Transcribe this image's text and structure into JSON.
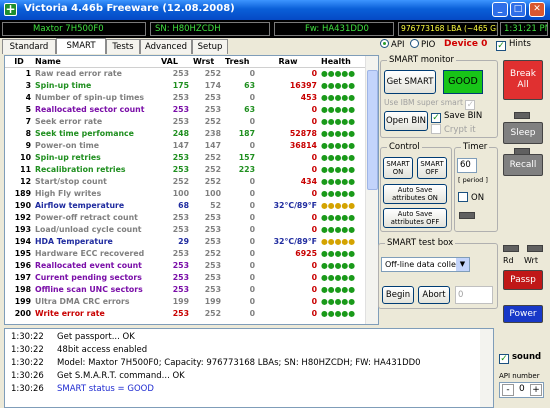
{
  "window": {
    "title": "Victoria 4.46b Freeware (12.08.2008)",
    "controls": {
      "minimize": "_",
      "maximize": "□",
      "close": "✕"
    }
  },
  "infobar": {
    "model": "Maxtor 7H500F0",
    "serial": "SN: H80HZCDH",
    "firmware": "Fw: HA431DD0",
    "lba": "976773168 LBA (~465 GB)",
    "time": "1:31:21 PM"
  },
  "tabs": [
    "Standard",
    "SMART",
    "Tests",
    "Advanced",
    "Setup"
  ],
  "active_tab": "SMART",
  "mode": {
    "api": "API",
    "pio": "PIO",
    "device": "Device 0",
    "selected": "API"
  },
  "hints_label": "Hints",
  "hints_checked": true,
  "smart_table": {
    "headers": [
      "ID",
      "Name",
      "VAL",
      "Wrst",
      "Tresh",
      "Raw",
      "Health"
    ],
    "rows": [
      {
        "id": "1",
        "name": "Raw read error rate",
        "val": "253",
        "wrst": "252",
        "tresh": "0",
        "raw": "0",
        "health": "●●●●●",
        "color": "grey",
        "tresh_color": "grey",
        "raw_color": "red"
      },
      {
        "id": "3",
        "name": "Spin-up time",
        "val": "175",
        "wrst": "174",
        "tresh": "63",
        "raw": "16397",
        "health": "●●●●●",
        "color": "green",
        "tresh_color": "green",
        "raw_color": "red"
      },
      {
        "id": "4",
        "name": "Number of spin-up times",
        "val": "253",
        "wrst": "253",
        "tresh": "0",
        "raw": "453",
        "health": "●●●●●",
        "color": "grey",
        "tresh_color": "grey",
        "raw_color": "red"
      },
      {
        "id": "5",
        "name": "Reallocated sector count",
        "val": "253",
        "wrst": "253",
        "tresh": "63",
        "raw": "0",
        "health": "●●●●●",
        "color": "purple",
        "tresh_color": "green",
        "raw_color": "red"
      },
      {
        "id": "7",
        "name": "Seek error rate",
        "val": "253",
        "wrst": "252",
        "tresh": "0",
        "raw": "0",
        "health": "●●●●●",
        "color": "grey",
        "tresh_color": "grey",
        "raw_color": "red"
      },
      {
        "id": "8",
        "name": "Seek time perfomance",
        "val": "248",
        "wrst": "238",
        "tresh": "187",
        "raw": "52878",
        "health": "●●●●●",
        "color": "green",
        "tresh_color": "green",
        "raw_color": "red"
      },
      {
        "id": "9",
        "name": "Power-on time",
        "val": "147",
        "wrst": "147",
        "tresh": "0",
        "raw": "36814",
        "health": "●●●●●",
        "color": "grey",
        "tresh_color": "grey",
        "raw_color": "red"
      },
      {
        "id": "10",
        "name": "Spin-up retries",
        "val": "253",
        "wrst": "252",
        "tresh": "157",
        "raw": "0",
        "health": "●●●●●",
        "color": "green",
        "tresh_color": "green",
        "raw_color": "red"
      },
      {
        "id": "11",
        "name": "Recalibration retries",
        "val": "253",
        "wrst": "252",
        "tresh": "223",
        "raw": "0",
        "health": "●●●●●",
        "color": "green",
        "tresh_color": "green",
        "raw_color": "red"
      },
      {
        "id": "12",
        "name": "Start/stop count",
        "val": "252",
        "wrst": "252",
        "tresh": "0",
        "raw": "434",
        "health": "●●●●●",
        "color": "grey",
        "tresh_color": "grey",
        "raw_color": "red"
      },
      {
        "id": "189",
        "name": "High Fly writes",
        "val": "100",
        "wrst": "100",
        "tresh": "0",
        "raw": "0",
        "health": "●●●●●",
        "color": "grey",
        "tresh_color": "grey",
        "raw_color": "red"
      },
      {
        "id": "190",
        "name": "Airflow temperature",
        "val": "68",
        "wrst": "52",
        "tresh": "0",
        "raw": "32°C/89°F",
        "health": "●●●●●",
        "color": "navy",
        "tresh_color": "grey",
        "raw_color": "navy",
        "health_color": "yellow"
      },
      {
        "id": "192",
        "name": "Power-off retract count",
        "val": "253",
        "wrst": "253",
        "tresh": "0",
        "raw": "0",
        "health": "●●●●●",
        "color": "grey",
        "tresh_color": "grey",
        "raw_color": "red"
      },
      {
        "id": "193",
        "name": "Load/unload cycle count",
        "val": "253",
        "wrst": "253",
        "tresh": "0",
        "raw": "0",
        "health": "●●●●●",
        "color": "grey",
        "tresh_color": "grey",
        "raw_color": "red"
      },
      {
        "id": "194",
        "name": "HDA Temperature",
        "val": "29",
        "wrst": "253",
        "tresh": "0",
        "raw": "32°C/89°F",
        "health": "●●●●●",
        "color": "navy",
        "tresh_color": "grey",
        "raw_color": "navy",
        "health_color": "yellow"
      },
      {
        "id": "195",
        "name": "Hardware ECC recovered",
        "val": "253",
        "wrst": "252",
        "tresh": "0",
        "raw": "6925",
        "health": "●●●●●",
        "color": "grey",
        "tresh_color": "grey",
        "raw_color": "red"
      },
      {
        "id": "196",
        "name": "Reallocated event count",
        "val": "253",
        "wrst": "253",
        "tresh": "0",
        "raw": "0",
        "health": "●●●●●",
        "color": "purple",
        "tresh_color": "grey",
        "raw_color": "red"
      },
      {
        "id": "197",
        "name": "Current pending sectors",
        "val": "253",
        "wrst": "253",
        "tresh": "0",
        "raw": "0",
        "health": "●●●●●",
        "color": "purple",
        "tresh_color": "grey",
        "raw_color": "red"
      },
      {
        "id": "198",
        "name": "Offline scan UNC sectors",
        "val": "253",
        "wrst": "253",
        "tresh": "0",
        "raw": "0",
        "health": "●●●●●",
        "color": "purple",
        "tresh_color": "grey",
        "raw_color": "red"
      },
      {
        "id": "199",
        "name": "Ultra DMA CRC errors",
        "val": "199",
        "wrst": "199",
        "tresh": "0",
        "raw": "0",
        "health": "●●●●●",
        "color": "grey",
        "tresh_color": "grey",
        "raw_color": "red"
      },
      {
        "id": "200",
        "name": "Write error rate",
        "val": "253",
        "wrst": "252",
        "tresh": "0",
        "raw": "0",
        "health": "●●●●●",
        "color": "red",
        "tresh_color": "grey",
        "raw_color": "red"
      }
    ]
  },
  "smart_monitor": {
    "label": "SMART monitor",
    "get_smart": "Get SMART",
    "status": "GOOD",
    "use_ibm": "Use IBM super smart",
    "open_bin": "Open BIN",
    "save_bin": "Save BIN",
    "crypt_it": "Crypt it"
  },
  "control": {
    "label": "Control",
    "smart_on": "SMART ON",
    "smart_off": "SMART OFF",
    "auto_save_on": "Auto Save attributes ON",
    "auto_save_off": "Auto Save attributes OFF"
  },
  "timer": {
    "label": "Timer",
    "value": "60",
    "period": "[ period ]",
    "on_label": "ON"
  },
  "smart_test": {
    "label": "SMART test box",
    "selected": "Off-line data collect",
    "begin": "Begin",
    "abort": "Abort",
    "value": "0"
  },
  "side_buttons": {
    "break_all": "Break All",
    "sleep": "Sleep",
    "recall": "Recall",
    "rd": "Rd",
    "wrt": "Wrt",
    "passp": "Passp",
    "power": "Power"
  },
  "log": [
    {
      "time": "1:30:22",
      "text": "Get passport... OK"
    },
    {
      "time": "1:30:22",
      "text": "48bit access enabled"
    },
    {
      "time": "1:30:22",
      "text": "Model: Maxtor 7H500F0; Capacity: 976773168 LBAs; SN: H80HZCDH; FW: HA431DD0"
    },
    {
      "time": "1:30:26",
      "text": "Get S.M.A.R.T. command... OK"
    },
    {
      "time": "1:30:26",
      "text": "SMART status = GOOD"
    }
  ],
  "sound_label": "sound",
  "sound_checked": true,
  "api_number_label": "API number",
  "api_number_value": "0",
  "api_minus": "-",
  "api_plus": "+"
}
